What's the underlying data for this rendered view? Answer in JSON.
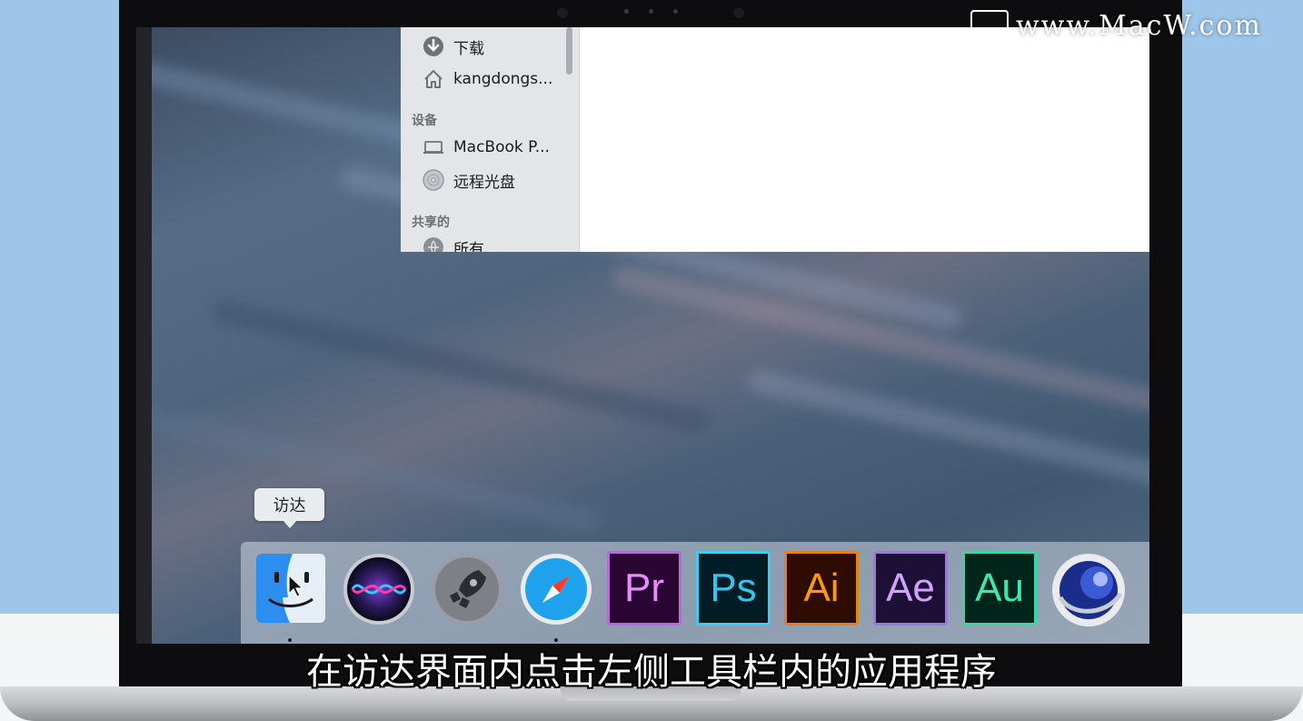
{
  "watermark": {
    "text": "www.MacW.com"
  },
  "finder": {
    "sidebar_items": [
      {
        "label": "下载",
        "icon": "download-icon"
      },
      {
        "label": "kangdongs...",
        "icon": "home-icon"
      }
    ],
    "devices_header": "设备",
    "devices": [
      {
        "label": "MacBook P...",
        "icon": "laptop-icon"
      },
      {
        "label": "远程光盘",
        "icon": "disc-icon"
      }
    ],
    "shared_header": "共享的",
    "shared": [
      {
        "label": "所有",
        "icon": "network-icon"
      }
    ]
  },
  "dock": {
    "tooltip": "访达",
    "apps": [
      {
        "name": "Finder",
        "icon": "finder-icon",
        "running": true
      },
      {
        "name": "Siri",
        "icon": "siri-icon",
        "running": false
      },
      {
        "name": "Launchpad",
        "icon": "launchpad-icon",
        "running": false
      },
      {
        "name": "Safari",
        "icon": "safari-icon",
        "running": true
      },
      {
        "label": "Pr",
        "icon": "premiere-icon",
        "bg": "#2a0634",
        "fg": "#e48ff7",
        "border": "#b86ad6"
      },
      {
        "label": "Ps",
        "icon": "photoshop-icon",
        "bg": "#001d26",
        "fg": "#31c5f0",
        "border": "#3ccdf5"
      },
      {
        "label": "Ai",
        "icon": "illustrator-icon",
        "bg": "#2e0c00",
        "fg": "#ff9a00",
        "border": "#e0821a"
      },
      {
        "label": "Ae",
        "icon": "aftereffects-icon",
        "bg": "#1c1037",
        "fg": "#d3a2ff",
        "border": "#9b7ad6"
      },
      {
        "label": "Au",
        "icon": "audition-icon",
        "bg": "#00261b",
        "fg": "#3fe6b0",
        "border": "#39d6a3"
      },
      {
        "name": "Cinema 4D",
        "icon": "cinema4d-icon",
        "running": false
      }
    ]
  },
  "subtitle": "在访达界面内点击左侧工具栏内的应用程序"
}
